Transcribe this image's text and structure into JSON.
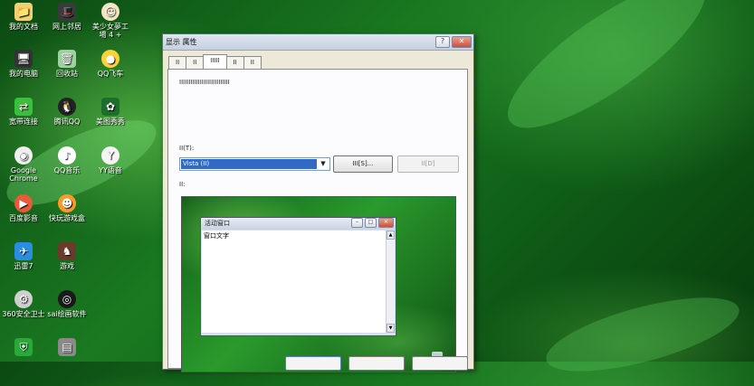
{
  "desktop_icons": [
    {
      "label": "我的文档",
      "icon": "documents-icon"
    },
    {
      "label": "网上邻居",
      "icon": "network-icon"
    },
    {
      "label": "美少女夢工\n場 4 +",
      "icon": "game-icon"
    },
    {
      "label": "我的电脑",
      "icon": "computer-icon"
    },
    {
      "label": "回收站",
      "icon": "recycle-bin-icon"
    },
    {
      "label": "QQ飞车",
      "icon": "qq-speed-icon"
    },
    {
      "label": "宽带连接",
      "icon": "broadband-icon"
    },
    {
      "label": "腾讯QQ",
      "icon": "qq-icon"
    },
    {
      "label": "美图秀秀",
      "icon": "meitu-icon"
    },
    {
      "label": "Google\nChrome",
      "icon": "chrome-icon"
    },
    {
      "label": "QQ音乐",
      "icon": "qq-music-icon"
    },
    {
      "label": "YY语音",
      "icon": "yy-icon"
    },
    {
      "label": "百度影音",
      "icon": "baidu-player-icon"
    },
    {
      "label": "快玩游戏盒",
      "icon": "game-box-icon"
    },
    {
      "label": "迅雷7",
      "icon": "thunder-icon"
    },
    {
      "label": "游戏",
      "icon": "games-folder-icon"
    },
    {
      "label": "360安全卫士",
      "icon": "security-360-icon"
    },
    {
      "label": "sai绘画软件",
      "icon": "sai-icon"
    }
  ],
  "dialog": {
    "title": "显示 属性",
    "tabs": [
      "II",
      "II",
      "IIIII",
      "II",
      "II"
    ],
    "description": "IIIIIIIIIIIIIIIIIIIIIIIIIII",
    "background_label": "II(T):",
    "background_value": "Vista (II)",
    "browse_button": "III[S]...",
    "position_button": "II[D]",
    "preview_label": "II:",
    "preview_window_title": "活动窗口",
    "preview_window_text": "窗口文字"
  },
  "colors": {
    "selection": "#316ac5",
    "dialog_face": "#ece9d8"
  }
}
